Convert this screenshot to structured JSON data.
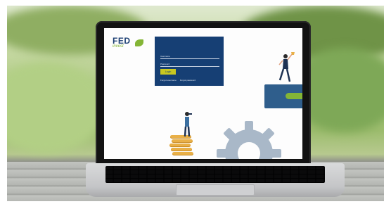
{
  "brand": {
    "name": "FED",
    "tagline": "invest"
  },
  "login_form": {
    "username_placeholder": "Username",
    "password_placeholder": "Password",
    "login_label": "Login",
    "forgot_username": "Forgot username",
    "forgot_password": "Forgot password"
  },
  "colors": {
    "brand_navy": "#163f74",
    "brand_green": "#84b536",
    "button_yellow": "#c9c820",
    "wallet_blue": "#2f5e8c",
    "coin_gold": "#e9b047",
    "gear_gray": "#a9b8c8"
  }
}
